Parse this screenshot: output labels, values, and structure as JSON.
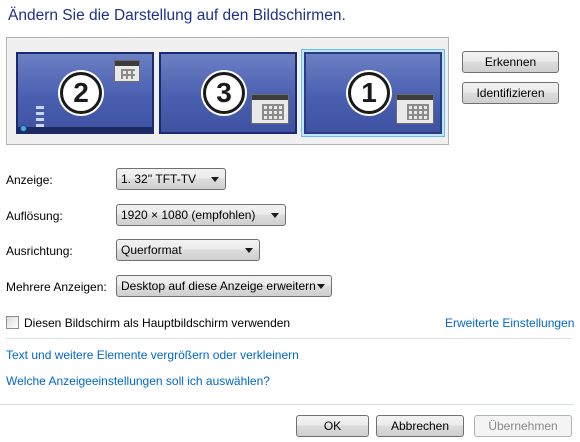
{
  "title": "Ändern Sie die Darstellung auf den Bildschirmen.",
  "monitors": [
    {
      "number": "2",
      "selected": false
    },
    {
      "number": "3",
      "selected": false
    },
    {
      "number": "1",
      "selected": true
    }
  ],
  "buttons": {
    "detect": "Erkennen",
    "identify": "Identifizieren",
    "ok": "OK",
    "cancel": "Abbrechen",
    "apply": "Übernehmen"
  },
  "settings": {
    "display": {
      "label": "Anzeige:",
      "value": "1. 32'' TFT-TV"
    },
    "resolution": {
      "label": "Auflösung:",
      "value": "1920 × 1080 (empfohlen)"
    },
    "orientation": {
      "label": "Ausrichtung:",
      "value": "Querformat"
    },
    "multiple": {
      "label": "Mehrere Anzeigen:",
      "value": "Desktop auf diese Anzeige erweitern"
    }
  },
  "main_display_checkbox": {
    "label": "Diesen Bildschirm als Hauptbildschirm verwenden",
    "checked": false
  },
  "links": {
    "advanced": "Erweiterte Einstellungen",
    "text_size": "Text und weitere Elemente vergrößern oder verkleinern",
    "which_settings": "Welche Anzeigeeinstellungen soll ich auswählen?"
  },
  "colors": {
    "title": "#1e3287",
    "link": "#0066cc",
    "monitor_fill": "#4a5fb0",
    "selection_glow": "#6fb8ec"
  }
}
